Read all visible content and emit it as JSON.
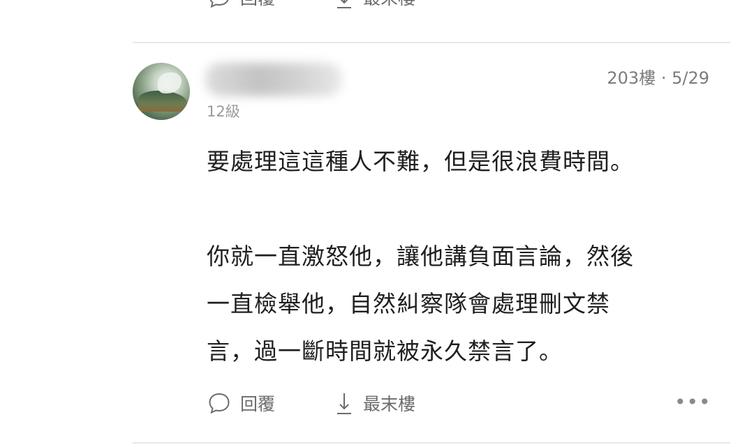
{
  "prev_post": {
    "reply_label": "回覆",
    "last_floor_label": "最末樓"
  },
  "comment": {
    "level": "12級",
    "floor": "203樓",
    "separator": "·",
    "date": "5/29",
    "content": {
      "line1": "要處理這這種人不難，但是很浪費時間。",
      "line2": "你就一直激怒他，讓他講負面言論，然後",
      "line3": "一直檢舉他，自然糾察隊會處理刪文禁",
      "line4": "言，過一斷時間就被永久禁言了。"
    },
    "actions": {
      "reply_label": "回覆",
      "last_floor_label": "最末樓",
      "more_icon": "more-dots-icon"
    }
  },
  "colors": {
    "divider": "#e8e8e8",
    "meta_text": "#7c7c7c",
    "body_text": "#1f1f1f"
  }
}
